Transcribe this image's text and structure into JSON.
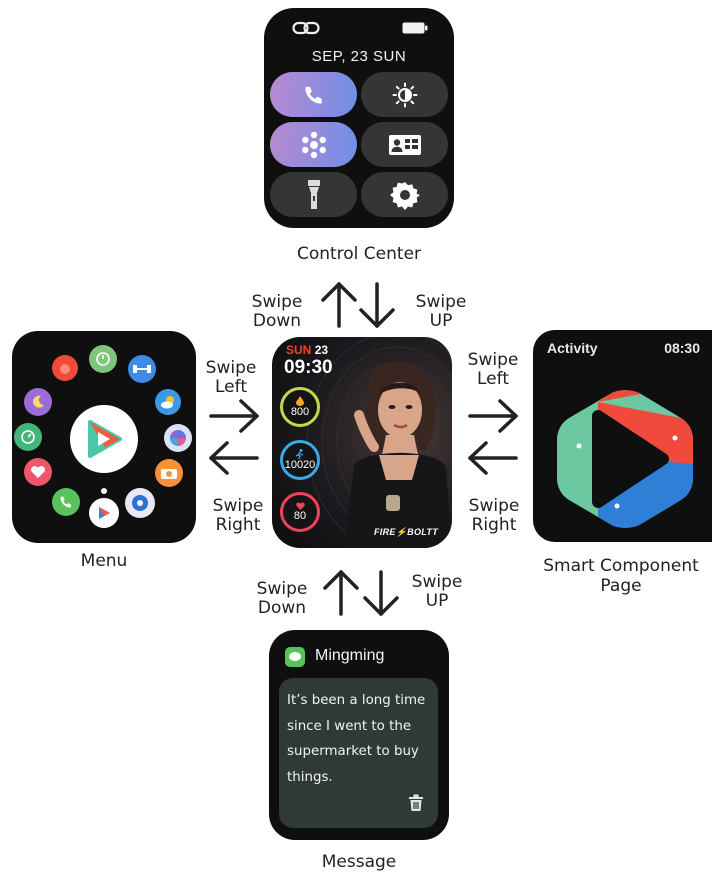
{
  "control_center": {
    "date": "SEP, 23 SUN",
    "caption": "Control Center",
    "icons": [
      "link-icon",
      "battery-icon",
      "phone-icon",
      "brightness-icon",
      "dots-icon",
      "id-card-icon",
      "flashlight-icon",
      "gear-icon"
    ]
  },
  "main_watch": {
    "day_name": "SUN",
    "day_num": "23",
    "time": "09:30",
    "metrics": [
      {
        "value": "800",
        "icon": "flame-icon",
        "color": "#c6d64a"
      },
      {
        "value": "10020",
        "icon": "runner-icon",
        "color": "#39a9e8"
      },
      {
        "value": "80",
        "icon": "heart-icon",
        "color": "#f0435a"
      }
    ],
    "brand": "FIRE⚡BOLTT"
  },
  "gestures": {
    "top_left": [
      "Swipe",
      "Down"
    ],
    "top_right": [
      "Swipe",
      "UP"
    ],
    "left_top": [
      "Swipe",
      "Left"
    ],
    "left_bottom": [
      "Swipe",
      "Right"
    ],
    "right_top": [
      "Swipe",
      "Left"
    ],
    "right_bottom": [
      "Swipe",
      "Right"
    ],
    "bottom_left": [
      "Swipe",
      "Down"
    ],
    "bottom_right": [
      "Swipe",
      "UP"
    ]
  },
  "menu": {
    "caption": "Menu",
    "apps": [
      "play-icon",
      "tomato-icon",
      "clock-icon",
      "dumbbell-icon",
      "weather-icon",
      "pinwheel-icon",
      "camera-icon",
      "compass-icon",
      "play-small-icon",
      "phone-icon",
      "heart-rate-icon",
      "gauge-icon",
      "moon-icon"
    ]
  },
  "smart": {
    "title": "Activity",
    "time": "08:30",
    "caption_line1": "Smart Component",
    "caption_line2": "Page"
  },
  "message": {
    "sender": "Mingming",
    "lines": [
      "It’s been a long time",
      "since I went to the",
      "supermarket to buy",
      "things."
    ],
    "caption": "Message"
  },
  "colors": {
    "accent_red": "#ff3b30",
    "message_green": "#5ac25a",
    "activity_red": "#ef4a3c",
    "activity_blue": "#2f7fd6",
    "activity_teal": "#6cc8a1"
  }
}
